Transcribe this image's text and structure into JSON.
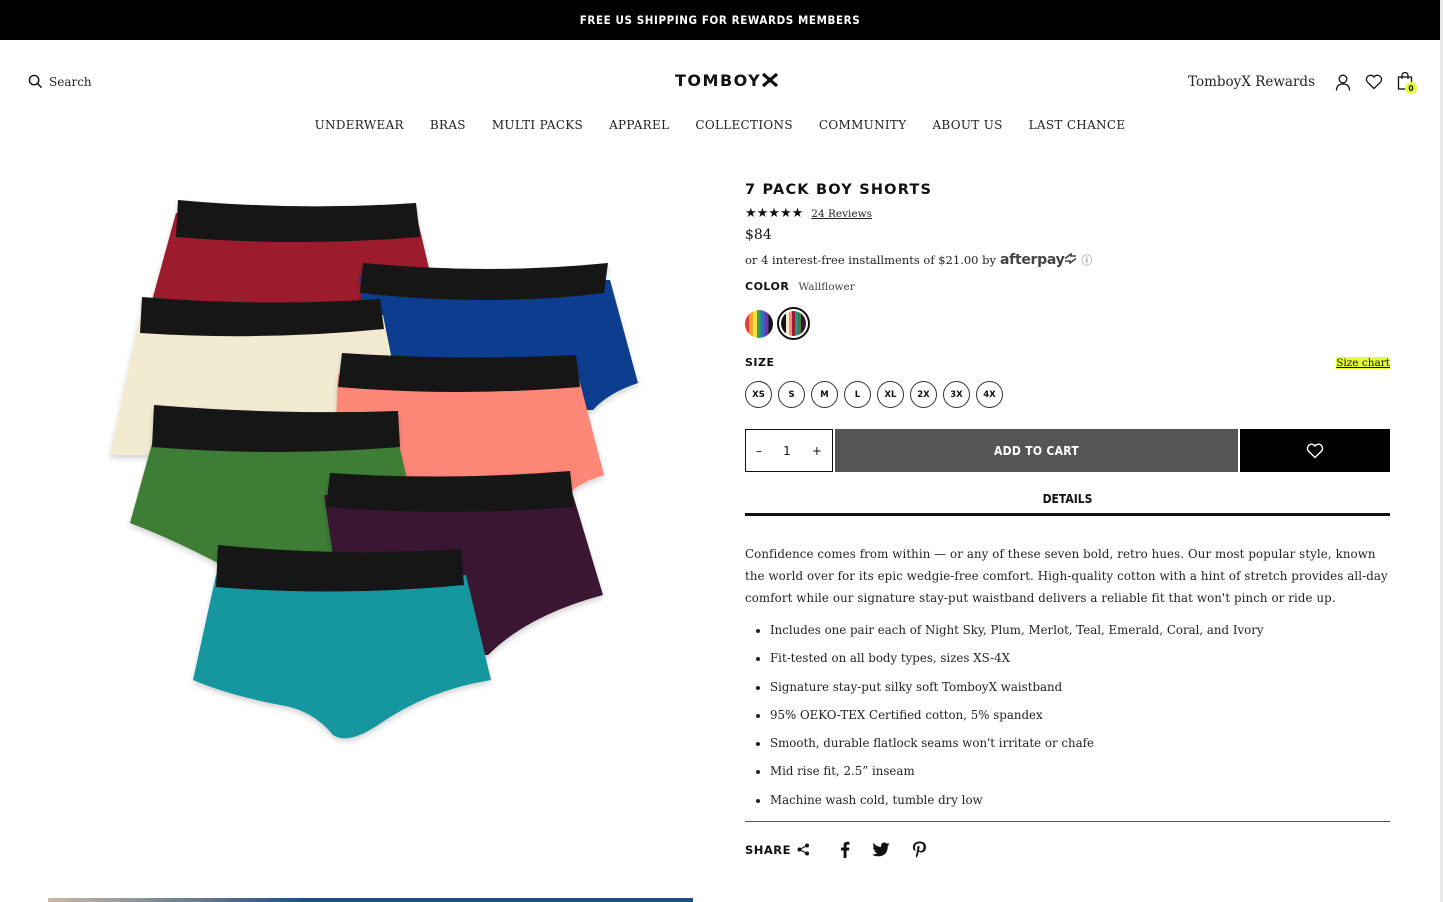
{
  "promo": {
    "text": "FREE US SHIPPING FOR REWARDS MEMBERS"
  },
  "header": {
    "search_label": "Search",
    "logo": "TOMBOY",
    "rewards_label": "TomboyX Rewards",
    "cart_count": "0"
  },
  "nav": {
    "items": [
      "UNDERWEAR",
      "BRAS",
      "MULTI PACKS",
      "APPAREL",
      "COLLECTIONS",
      "COMMUNITY",
      "ABOUT US",
      "LAST CHANCE"
    ]
  },
  "product": {
    "title": "7 PACK BOY SHORTS",
    "rating": 5,
    "reviews": "24 Reviews",
    "price": "$84",
    "afterpay_text": "or 4 interest-free installments of $21.00 by",
    "afterpay_logo": "afterpay",
    "color_label": "COLOR",
    "color_name": "Wallflower",
    "size_label": "SIZE",
    "size_chart": "Size chart",
    "sizes": [
      "XS",
      "S",
      "M",
      "L",
      "XL",
      "2X",
      "3X",
      "4X"
    ],
    "quantity": "1",
    "qty_minus": "–",
    "qty_plus": "+",
    "add_to_cart": "ADD TO CART",
    "details_tab": "DETAILS",
    "description": "Confidence comes from within — or any of these seven bold, retro hues. Our most popular style, known the world over for its epic wedgie-free comfort. High-quality cotton with a hint of stretch provides all-day comfort while our signature stay-put waistband delivers a reliable fit that won't pinch or ride up.",
    "bullets": [
      "Includes one pair each of Night Sky, Plum, Merlot, Teal, Emerald, Coral, and Ivory",
      "Fit-tested on all body types, sizes XS-4X",
      "Signature stay-put silky soft TomboyX waistband",
      "95% OEKO-TEX Certified cotton, 5% spandex",
      "Smooth, durable flatlock seams won't irritate or chafe",
      "Mid rise fit, 2.5” inseam",
      "Machine wash cold, tumble dry low"
    ],
    "share_label": "SHARE"
  },
  "colors": {
    "merlot": "#9c1c2e",
    "night_sky": "#0a3d8f",
    "ivory": "#f3ead2",
    "coral": "#ff8778",
    "emerald": "#3e7d36",
    "plum": "#3b1532",
    "teal": "#15969e",
    "band": "#141414",
    "accent": "#e5ff3d"
  }
}
